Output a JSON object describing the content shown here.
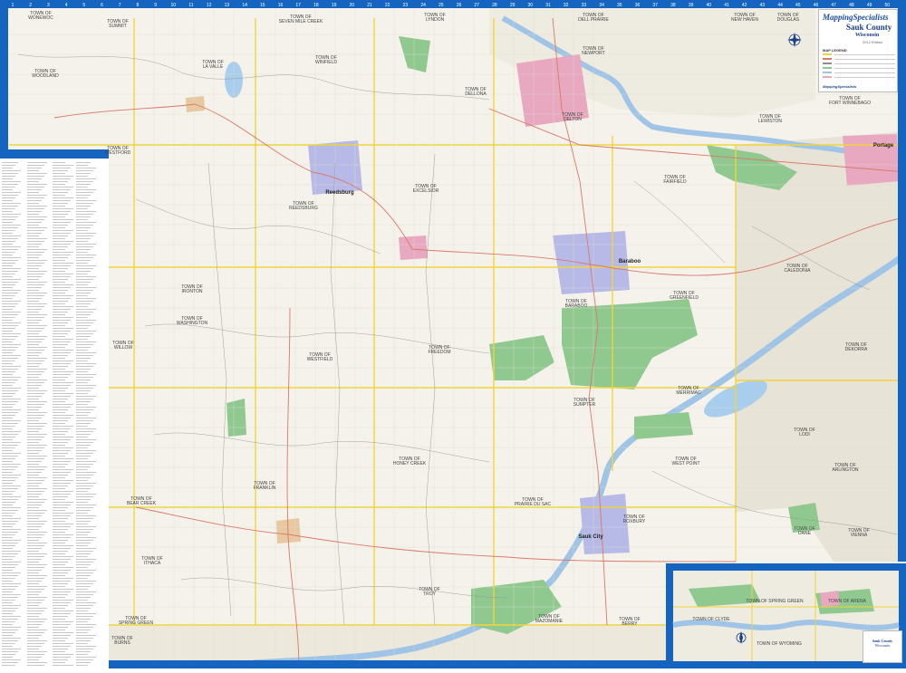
{
  "brand": "MappingSpecialists",
  "map_title": "Sauk County",
  "map_subtitle": "Wisconsin",
  "edition": "2012 Edition",
  "legend_header": "MAP LEGEND",
  "colors": {
    "water": "#b8d4ec",
    "park": "#8fc98f",
    "urban": "#e8a8c0",
    "city": "#b7b9e6",
    "hwy": "#f2d43c",
    "frame": "#1565c0",
    "paper": "#f4f2ea"
  },
  "towns": [
    {
      "name": "TOWN OF WOODLAND"
    },
    {
      "name": "TOWN OF LA VALLE"
    },
    {
      "name": "TOWN OF WINFIELD"
    },
    {
      "name": "TOWN OF DELLONA"
    },
    {
      "name": "TOWN OF DELTON"
    },
    {
      "name": "TOWN OF NEWPORT"
    },
    {
      "name": "TOWN OF LEWISTON"
    },
    {
      "name": "TOWN OF FORT WINNEBAGO"
    },
    {
      "name": "TOWN OF WESTFORD"
    },
    {
      "name": "TOWN OF REEDSBURG"
    },
    {
      "name": "TOWN OF EXCELSIOR"
    },
    {
      "name": "TOWN OF FAIRFIELD"
    },
    {
      "name": "TOWN OF CALEDONIA"
    },
    {
      "name": "TOWN OF IRONTON"
    },
    {
      "name": "TOWN OF BARABOO"
    },
    {
      "name": "TOWN OF GREENFIELD"
    },
    {
      "name": "TOWN OF WASHINGTON"
    },
    {
      "name": "TOWN OF WESTFIELD"
    },
    {
      "name": "TOWN OF FREEDOM"
    },
    {
      "name": "TOWN OF WILLOW"
    },
    {
      "name": "TOWN OF SUMPTER"
    },
    {
      "name": "TOWN OF MERRIMAC"
    },
    {
      "name": "TOWN OF DEKORRA"
    },
    {
      "name": "TOWN OF LODI"
    },
    {
      "name": "TOWN OF WEST POINT"
    },
    {
      "name": "TOWN OF ARLINGTON"
    },
    {
      "name": "TOWN OF BEAR CREEK"
    },
    {
      "name": "TOWN OF FRANKLIN"
    },
    {
      "name": "TOWN OF HONEY CREEK"
    },
    {
      "name": "TOWN OF PRAIRIE DU SAC"
    },
    {
      "name": "TOWN OF ROXBURY"
    },
    {
      "name": "TOWN OF DANE"
    },
    {
      "name": "TOWN OF VIENNA"
    },
    {
      "name": "TOWN OF SPRING GREEN"
    },
    {
      "name": "TOWN OF TROY"
    },
    {
      "name": "TOWN OF MAZOMANIE"
    },
    {
      "name": "TOWN OF BERRY"
    },
    {
      "name": "TOWN OF BURNS"
    },
    {
      "name": "TOWN OF ITHACA"
    },
    {
      "name": "TOWN OF SUMMIT"
    },
    {
      "name": "TOWN OF SEVEN MILE CREEK"
    },
    {
      "name": "TOWN OF LYNDON"
    },
    {
      "name": "TOWN OF DELL PRAIRIE"
    },
    {
      "name": "TOWN OF NEW HAVEN"
    },
    {
      "name": "TOWN OF DOUGLAS"
    },
    {
      "name": "TOWN OF WONEWOC"
    }
  ],
  "cities": [
    {
      "name": "Reedsburg"
    },
    {
      "name": "Baraboo"
    },
    {
      "name": "Portage"
    },
    {
      "name": "Sauk City"
    }
  ],
  "inset_towns": [
    {
      "name": "TOWN OF SPRING GREEN"
    },
    {
      "name": "TOWN OF ARENA"
    },
    {
      "name": "TOWN OF CLYDE"
    },
    {
      "name": "TOWN OF WYOMING"
    }
  ],
  "inset_legend": {
    "title": "Sauk County",
    "sub": "Wisconsin"
  }
}
